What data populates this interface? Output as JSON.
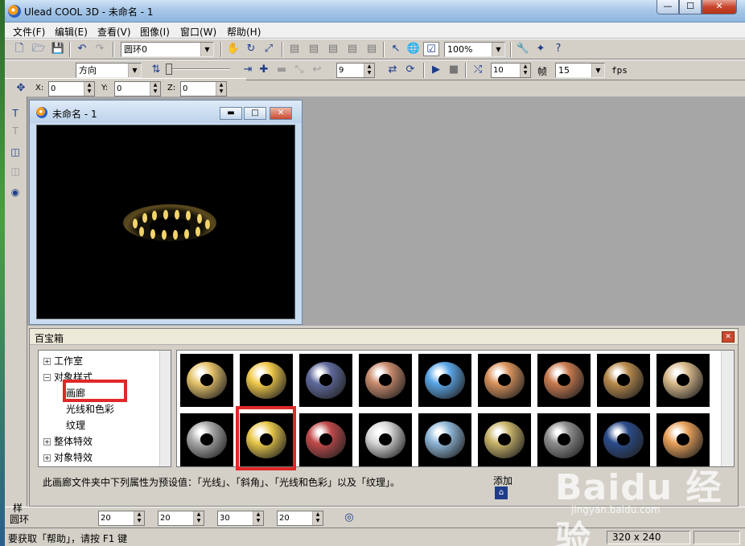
{
  "window": {
    "title": "Ulead COOL 3D - 未命名 - 1",
    "min_glyph": "—",
    "max_glyph": "☐",
    "close_glyph": "✕"
  },
  "menu": [
    "文件(F)",
    "编辑(E)",
    "查看(V)",
    "图像(I)",
    "窗口(W)",
    "帮助(H)"
  ],
  "toolbar": {
    "object_combo": "圆环0",
    "zoom": "100%",
    "direction_combo": "方向",
    "frame_spin": "9",
    "fps_frames": "10",
    "frames_label": "帧",
    "fps_value": "15",
    "fps_label": "fps"
  },
  "position": {
    "x_label": "X:",
    "x_value": "0",
    "y_label": "Y:",
    "y_value": "0",
    "z_label": "Z:",
    "z_value": "0"
  },
  "document": {
    "title": "未命名 - 1"
  },
  "panel": {
    "title": "百宝箱",
    "tree": [
      {
        "label": "工作室",
        "expander": "+"
      },
      {
        "label": "对象样式",
        "expander": "−"
      },
      {
        "label": "画廊",
        "expander": ""
      },
      {
        "label": "光线和色彩",
        "expander": ""
      },
      {
        "label": "纹理",
        "expander": ""
      },
      {
        "label": "整体特效",
        "expander": "+"
      },
      {
        "label": "对象特效",
        "expander": "+"
      }
    ],
    "info_text": "此画廊文件夹中下列属性为预设值：「光线」、「斜角」、「光线和色彩」以及「纹理」。",
    "add_label": "添加"
  },
  "gallery": {
    "colors": [
      "#e6c36a",
      "#f0c94a",
      "#5f6a9c",
      "#c98b6d",
      "#5aa6e6",
      "#d8925c",
      "#c97a4f",
      "#b88a4c",
      "#d7b98b",
      "#a9a9a9",
      "#e8c84a",
      "#c04a4a",
      "#d8d8d8",
      "#8fb7d8",
      "#c8b46a",
      "#8e8e8e",
      "#2a4b8a",
      "#e8a05a"
    ]
  },
  "properties": {
    "cut_label": "样",
    "object_name": "圆环",
    "v1": "20",
    "v2": "20",
    "v3": "30",
    "v4": "20"
  },
  "status": {
    "help_text": "要获取「帮助」，请按 F1 键",
    "size": "320 x 240"
  },
  "watermark": {
    "main": "Baidu 经验",
    "sub": "jingyan.baidu.com"
  }
}
